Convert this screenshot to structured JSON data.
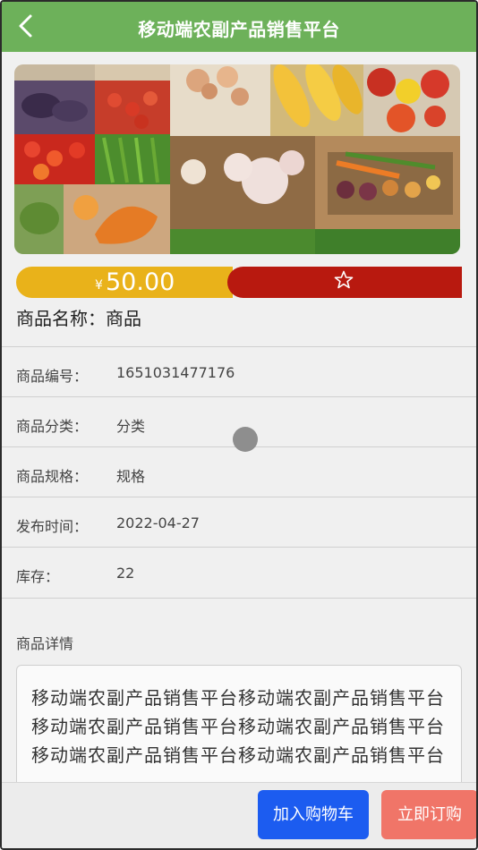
{
  "header": {
    "title": "移动端农副产品销售平台",
    "back_icon": "chevron-left-icon"
  },
  "banner": {
    "image_name": "vegetables-collage"
  },
  "price_bar": {
    "currency": "¥",
    "price": "50.00",
    "favorite_icon": "star-outline-icon"
  },
  "product": {
    "name_label": "商品名称：",
    "name_value": "商品",
    "fields": [
      {
        "label": "商品编号：",
        "value": "1651031477176"
      },
      {
        "label": "商品分类：",
        "value": "分类"
      },
      {
        "label": "商品规格：",
        "value": "规格"
      },
      {
        "label": "发布时间：",
        "value": "2022-04-27"
      },
      {
        "label": "库存：",
        "value": "22"
      }
    ],
    "details_title": "商品详情",
    "details_text": "移动端农副产品销售平台移动端农副产品销售平台移动端农副产品销售平台移动端农副产品销售平台移动端农副产品销售平台移动端农副产品销售平台"
  },
  "actions": {
    "add_to_cart": "加入购物车",
    "buy_now": "立即订购"
  },
  "colors": {
    "header": "#6db15a",
    "price_left": "#e9b21a",
    "price_right": "#b8190f",
    "cart_button": "#1c5cf0",
    "buy_button": "#f07568"
  }
}
